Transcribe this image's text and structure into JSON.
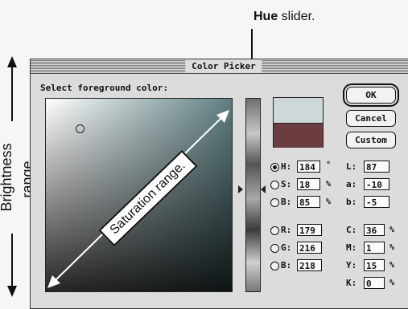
{
  "annotations": {
    "hue_bold": "Hue",
    "hue_rest": " slider.",
    "brightness": "Brightness range.",
    "saturation": "Saturation range."
  },
  "window": {
    "title": "Color Picker",
    "prompt": "Select foreground color:"
  },
  "buttons": {
    "ok": "OK",
    "cancel": "Cancel",
    "custom": "Custom"
  },
  "hsb": [
    {
      "label": "H:",
      "value": "184",
      "unit": "°",
      "selected": true
    },
    {
      "label": "S:",
      "value": "18",
      "unit": "%",
      "selected": false
    },
    {
      "label": "B:",
      "value": "85",
      "unit": "%",
      "selected": false
    }
  ],
  "rgb": [
    {
      "label": "R:",
      "value": "179"
    },
    {
      "label": "G:",
      "value": "216"
    },
    {
      "label": "B:",
      "value": "218"
    }
  ],
  "lab": [
    {
      "label": "L:",
      "value": "87"
    },
    {
      "label": "a:",
      "value": "-10"
    },
    {
      "label": "b:",
      "value": "-5"
    }
  ],
  "cmyk": [
    {
      "label": "C:",
      "value": "36",
      "unit": "%"
    },
    {
      "label": "M:",
      "value": "1",
      "unit": "%"
    },
    {
      "label": "Y:",
      "value": "15",
      "unit": "%"
    },
    {
      "label": "K:",
      "value": "0",
      "unit": "%"
    }
  ],
  "colors": {
    "new_color": "#cfd8d8",
    "original_color": "#6b3d3f"
  }
}
